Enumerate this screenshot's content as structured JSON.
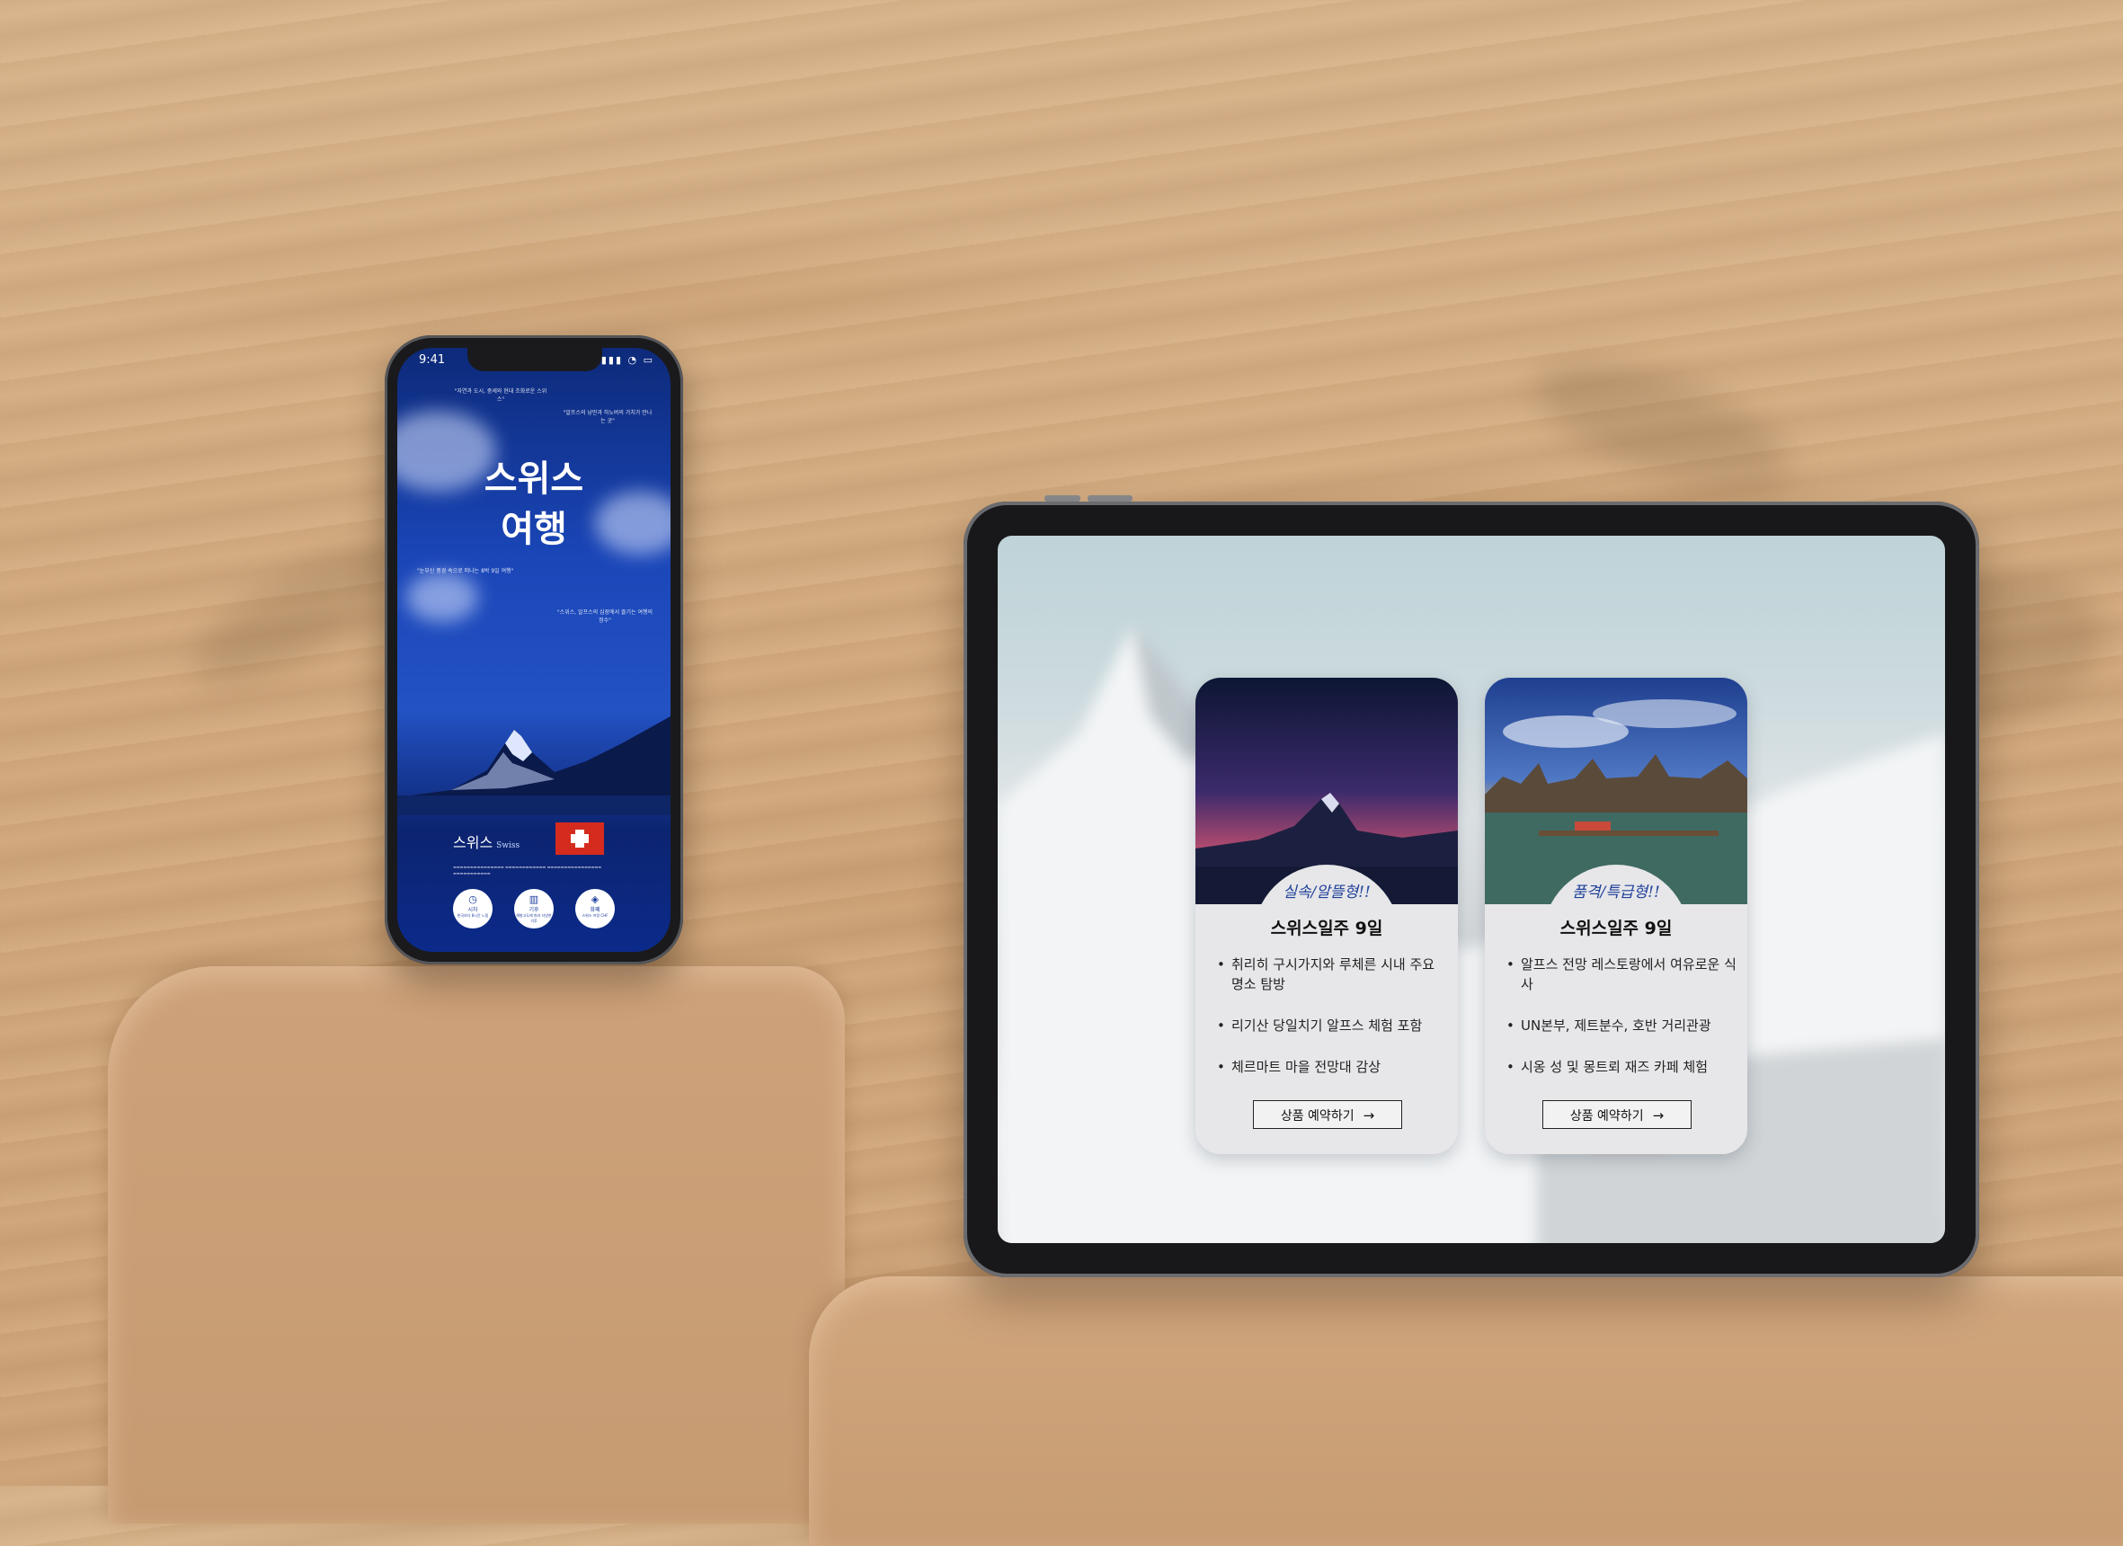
{
  "phone": {
    "status_time": "9:41",
    "title_line1": "스위스",
    "title_line2": "여행",
    "country_label": "스위스",
    "country_label_en": "Swiss",
    "quotes": [
      "\"자연과 도시, 중세와 현대 조화로운 스위스\"",
      "\"알프스의 낭만과 하노버의 가치가 만나는 곳\"",
      "\"눈부신 풍경 속으로 떠나는 8박 9일 여행\"",
      "\"스위스, 알프스의 심장에서 즐기는 여행의 정수\""
    ],
    "info_buttons": [
      {
        "icon": "clock-icon",
        "label": "시차",
        "sub": "한국보다 8시간 느림"
      },
      {
        "icon": "building-icon",
        "label": "기후",
        "sub": "해발고도에 따라 다양한 기후"
      },
      {
        "icon": "coin-icon",
        "label": "화폐",
        "sub": "스위스 프랑 CHF"
      }
    ]
  },
  "tablet": {
    "cards": [
      {
        "tag": "실속/알뜰형!!",
        "title": "스위스일주 9일",
        "bullets": [
          "취리히 구시가지와 루체른 시내 주요 명소 탐방",
          "리기산 당일치기 알프스 체험 포함",
          "체르마트 마을 전망대 감상"
        ],
        "button": "상품 예약하기"
      },
      {
        "tag": "품격/특급형!!",
        "title": "스위스일주 9일",
        "bullets": [
          "알프스 전망 레스토랑에서 여유로운 식사",
          "UN본부, 제트분수, 호반 거리관광",
          "시옹 성 및 몽트뢰 재즈 카페 체험"
        ],
        "button": "상품 예약하기"
      }
    ]
  },
  "colors": {
    "accent_blue": "#1f3f9a",
    "flag_red": "#d52b1e"
  }
}
